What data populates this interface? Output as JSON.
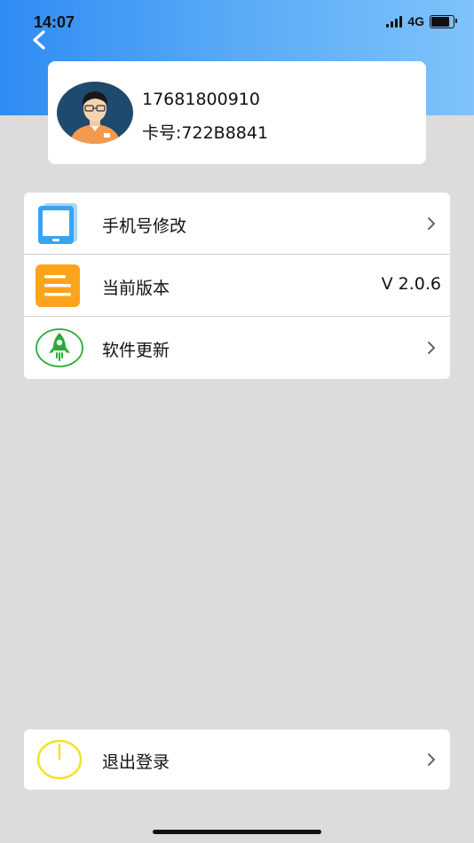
{
  "status_bar": {
    "time": "14:07",
    "network": "4G",
    "battery_level": 0.85
  },
  "header": {
    "back_icon": "chevron-left-icon",
    "gradient": [
      "#2f8cf4",
      "#7ec3fb"
    ]
  },
  "profile": {
    "avatar_icon": "user-avatar-icon",
    "phone": "17681800910",
    "card_number": "卡号:722B8841"
  },
  "menu": {
    "items": [
      {
        "label": "手机号修改",
        "icon": "tablet-icon",
        "has_arrow": true
      },
      {
        "label": "当前版本",
        "icon": "document-lines-icon",
        "value": "V 2.0.6"
      },
      {
        "label": "软件更新",
        "icon": "rocket-icon",
        "has_arrow": true
      }
    ]
  },
  "logout": {
    "label": "退出登录",
    "icon": "power-icon"
  },
  "colors": {
    "accent_blue": "#2f8cf4",
    "orange": "#fba41b",
    "green": "#2bab36",
    "yellow": "#f3e12c"
  }
}
